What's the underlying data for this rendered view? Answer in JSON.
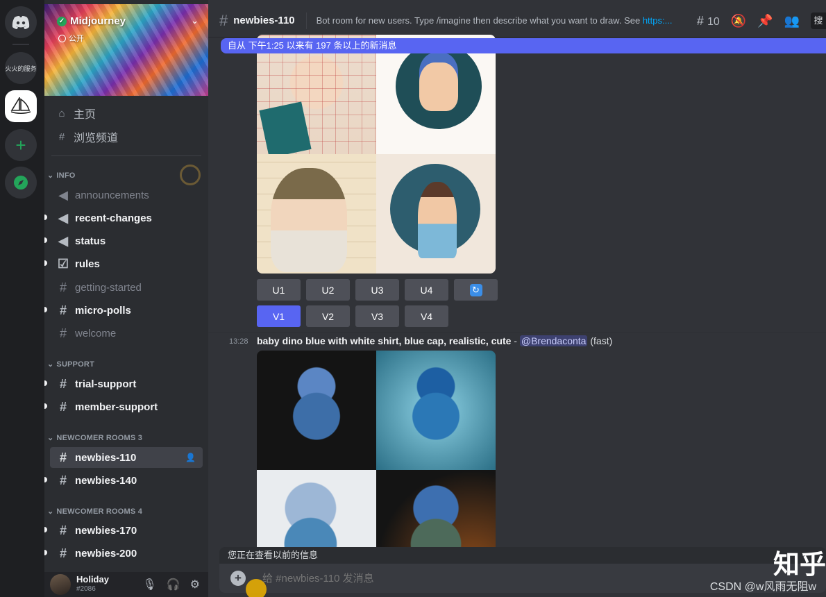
{
  "servers": {
    "discord_home": "discord-logo",
    "fire_label": "火火的服务",
    "midjourney": "midjourney-sail-logo",
    "add": "+",
    "explore": "compass-icon"
  },
  "server_header": {
    "name": "Midjourney",
    "visibility": "公开"
  },
  "nav": {
    "home": "主页",
    "browse": "浏览频道"
  },
  "categories": [
    {
      "name": "INFO",
      "channels": [
        {
          "name": "announcements",
          "icon": "megaphone-icon",
          "state": "muted"
        },
        {
          "name": "recent-changes",
          "icon": "megaphone-icon",
          "state": "unread"
        },
        {
          "name": "status",
          "icon": "megaphone-icon",
          "state": "unread"
        },
        {
          "name": "rules",
          "icon": "checkbox-icon",
          "state": "unread"
        },
        {
          "name": "getting-started",
          "icon": "hash-icon",
          "state": "muted"
        },
        {
          "name": "micro-polls",
          "icon": "hash-icon",
          "state": "unread"
        },
        {
          "name": "welcome",
          "icon": "hash-icon",
          "state": "muted"
        }
      ]
    },
    {
      "name": "SUPPORT",
      "channels": [
        {
          "name": "trial-support",
          "icon": "hash-icon",
          "state": "unread"
        },
        {
          "name": "member-support",
          "icon": "thread-hash-icon",
          "state": "unread"
        }
      ]
    },
    {
      "name": "NEWCOMER ROOMS 3",
      "channels": [
        {
          "name": "newbies-110",
          "icon": "thread-hash-icon",
          "state": "active"
        },
        {
          "name": "newbies-140",
          "icon": "thread-hash-icon",
          "state": "unread"
        }
      ]
    },
    {
      "name": "NEWCOMER ROOMS 4",
      "channels": [
        {
          "name": "newbies-170",
          "icon": "thread-hash-icon",
          "state": "unread"
        },
        {
          "name": "newbies-200",
          "icon": "thread-hash-icon",
          "state": "unread"
        }
      ]
    }
  ],
  "user": {
    "name": "Holiday",
    "tag": "#2086"
  },
  "channel_header": {
    "name": "newbies-110",
    "topic": "Bot room for new users. Type /imagine then describe what you want to draw. See ",
    "topic_link": "https:...",
    "thread_count": "10",
    "search_label": "搜"
  },
  "new_messages_bar": "自从 下午1:25 以来有 197 条以上的新消息",
  "first_message": {
    "upscale_buttons": [
      "U1",
      "U2",
      "U3",
      "U4"
    ],
    "variation_buttons": [
      "V1",
      "V2",
      "V3",
      "V4"
    ]
  },
  "second_message": {
    "time": "13:28",
    "prompt": "baby dino blue with white shirt, blue cap, realistic, cute",
    "separator": " - ",
    "mention": "@Brendaconta",
    "speed": "(fast)"
  },
  "composer": {
    "viewing_older": "您正在查看以前的信息",
    "placeholder": "给 #newbies-110 发消息"
  },
  "watermarks": {
    "zhihu": "知乎",
    "csdn": "CSDN @w风雨无阻w"
  },
  "colors": {
    "accent": "#5865f2",
    "online": "#23a55a",
    "link": "#00a8fc"
  }
}
